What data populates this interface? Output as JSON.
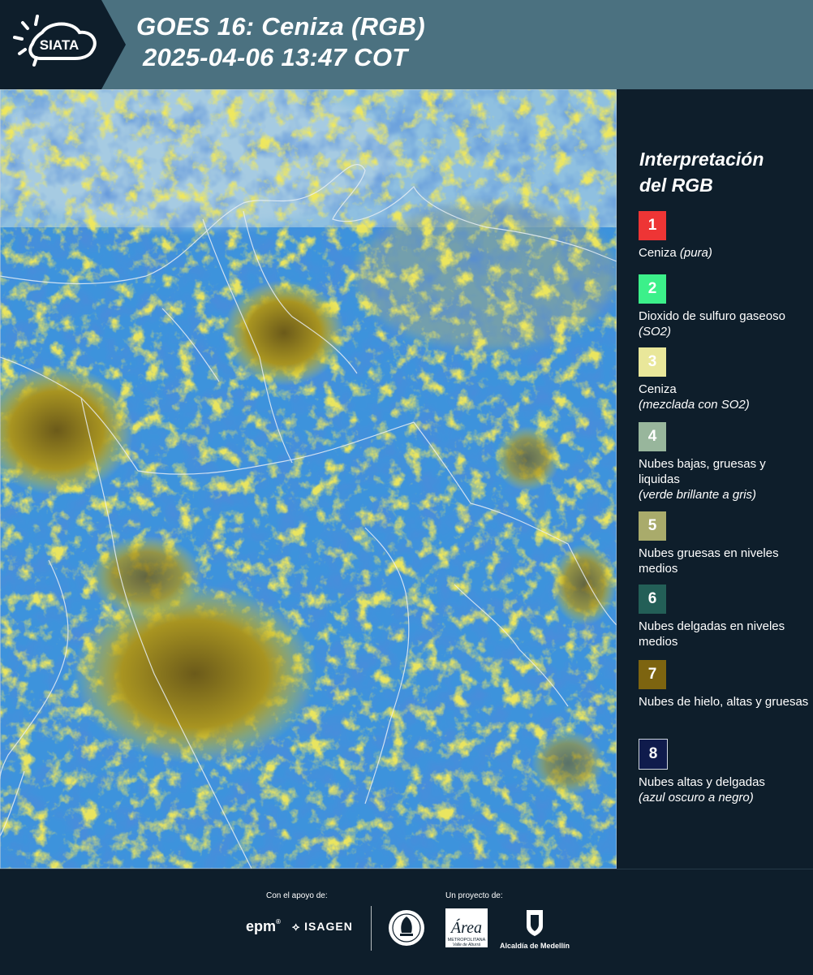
{
  "header": {
    "logo_text": "SIATA",
    "title_line1": "GOES 16: Ceniza (RGB)",
    "title_line2": "2025-04-06 13:47 COT",
    "background_color": "#4b7180"
  },
  "legend": {
    "title_line1": "Interpretación",
    "title_line2": "del RGB",
    "items": [
      {
        "number": "1",
        "color": "#ee3535",
        "text": "Ceniza",
        "note": "(pura)",
        "note_inline": true
      },
      {
        "number": "2",
        "color": "#3cf08a",
        "text": "Dioxido de sulfuro gaseoso",
        "note": "(SO2)",
        "note_inline": true
      },
      {
        "number": "3",
        "color": "#e9e79a",
        "text": "Ceniza",
        "note": "(mezclada con SO2)",
        "note_inline": false
      },
      {
        "number": "4",
        "color": "#98b69c",
        "text": "Nubes bajas, gruesas y liquidas",
        "note": "(verde brillante a gris)",
        "note_inline": false
      },
      {
        "number": "5",
        "color": "#a9ab6b",
        "text": "Nubes gruesas en niveles medios",
        "note": "",
        "note_inline": false
      },
      {
        "number": "6",
        "color": "#235f57",
        "text": "Nubes delgadas en niveles medios",
        "note": "",
        "note_inline": false
      },
      {
        "number": "7",
        "color": "#7d6410",
        "text": "Nubes de hielo, altas y gruesas",
        "note": "",
        "note_inline": false
      },
      {
        "number": "8",
        "color": "#0f1b4c",
        "text": "Nubes altas y delgadas",
        "note": "(azul oscuro a negro)",
        "note_inline": false
      }
    ]
  },
  "footer": {
    "support_label": "Con el apoyo de:",
    "project_label": "Un proyecto de:",
    "epm_text": "epm",
    "isagen_text": "ISAGEN",
    "area_line1": "METROPOLITANA",
    "area_line2": "Valle de Aburrá",
    "alcaldia_text": "Alcaldía de Medellín"
  }
}
